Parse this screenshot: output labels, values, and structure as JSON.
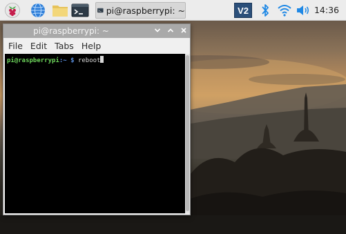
{
  "taskbar": {
    "icons": [
      "raspberry-pi-menu-icon",
      "web-browser-icon",
      "file-manager-icon",
      "terminal-icon"
    ],
    "task_button": {
      "label": "pi@raspberrypi: ~"
    },
    "tray": {
      "vnc_label": "V2",
      "icons": [
        "vnc-icon",
        "bluetooth-icon",
        "wifi-icon",
        "volume-icon"
      ]
    },
    "clock": "14:36"
  },
  "window": {
    "title": "pi@raspberrypi: ~",
    "controls": [
      "minimize-icon",
      "maximize-icon",
      "close-icon"
    ],
    "menu": [
      "File",
      "Edit",
      "Tabs",
      "Help"
    ],
    "terminal": {
      "user_host": "pi@raspberrypi",
      "path": ":~ $",
      "command": " reboot"
    }
  },
  "colors": {
    "taskbar_bg": "#ececec",
    "titlebar_bg": "#a9a9a9",
    "terminal_bg": "#000000",
    "prompt_user": "#6cd35a",
    "prompt_path": "#5a8fe0",
    "raspberry": "#c51a4a",
    "tray_blue": "#1e88e5"
  }
}
